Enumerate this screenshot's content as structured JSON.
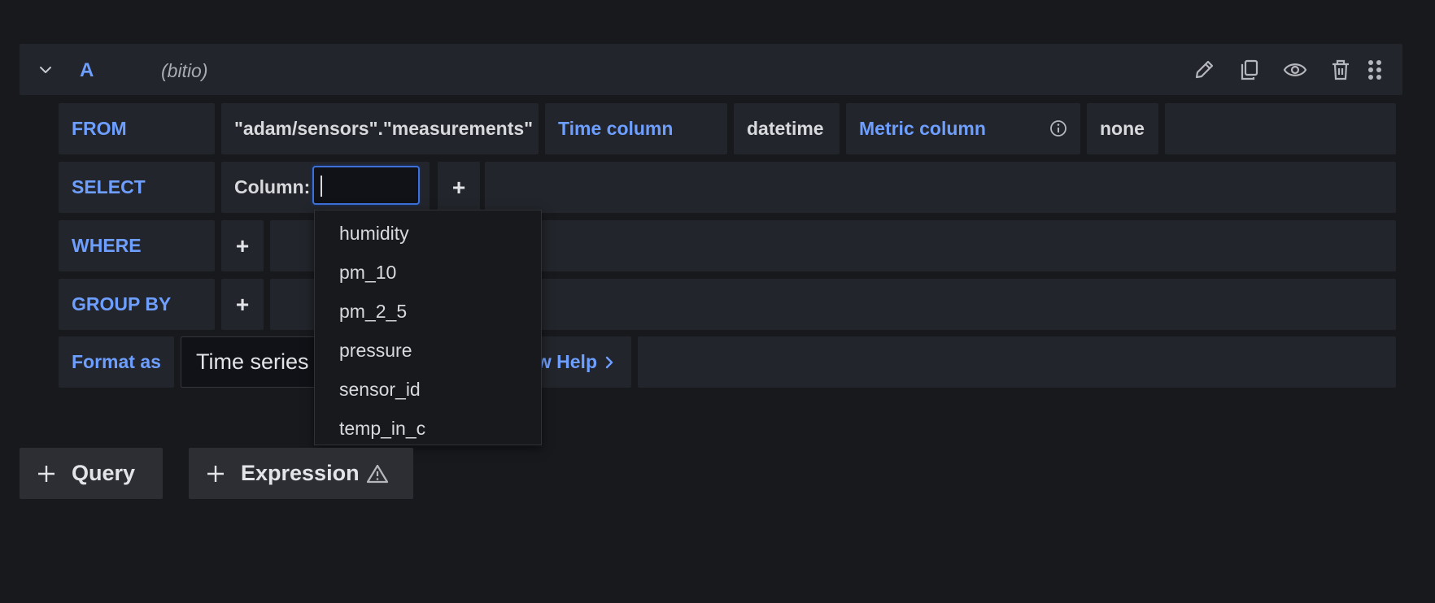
{
  "header": {
    "ref_id": "A",
    "datasource": "(bitio)",
    "icons": [
      "chevron-down-icon",
      "pencil-icon",
      "copy-icon",
      "eye-icon",
      "trash-icon",
      "drag-handle-icon"
    ]
  },
  "from_row": {
    "keyword": "FROM",
    "table": "\"adam/sensors\".\"measurements\"",
    "time_column_label": "Time column",
    "time_column_value": "datetime",
    "metric_column_label": "Metric column",
    "metric_column_value": "none"
  },
  "select_row": {
    "keyword": "SELECT",
    "column_label": "Column:",
    "column_value": "",
    "add": "+"
  },
  "where_row": {
    "keyword": "WHERE",
    "add": "+"
  },
  "groupby_row": {
    "keyword": "GROUP BY",
    "add": "+"
  },
  "format_row": {
    "keyword": "Format as",
    "format_value": "Time series",
    "help_label": "Show Help"
  },
  "dropdown": {
    "options": [
      "humidity",
      "pm_10",
      "pm_2_5",
      "pressure",
      "sensor_id",
      "temp_in_c"
    ]
  },
  "buttons": {
    "query": "Query",
    "expression": "Expression"
  },
  "colors": {
    "background": "#18191d",
    "panel": "#22252b",
    "accent": "#6e9fff",
    "input_border": "#3d71d9"
  }
}
